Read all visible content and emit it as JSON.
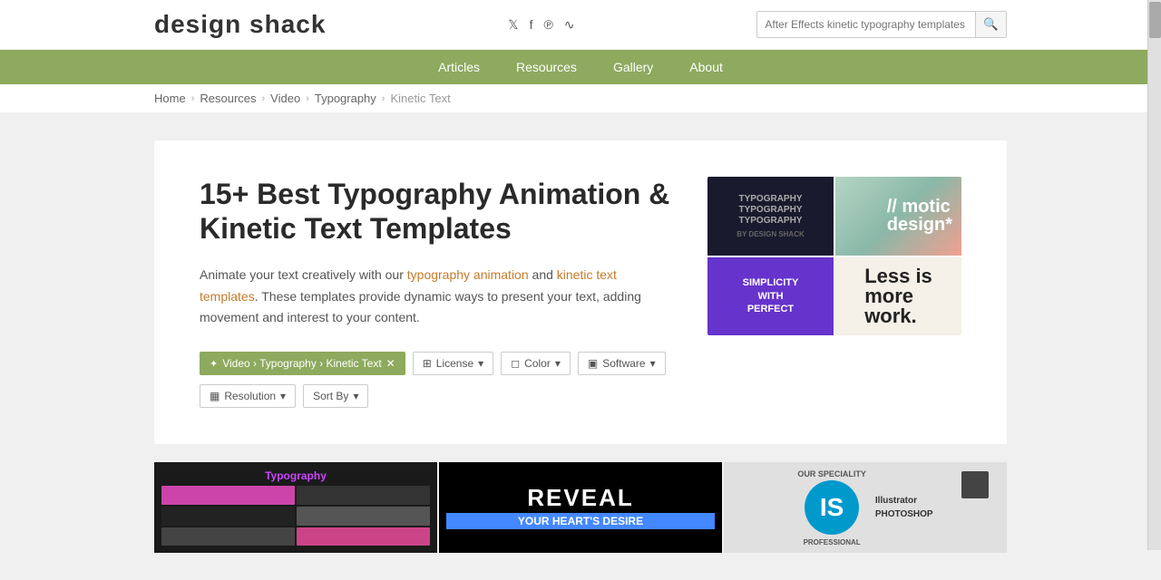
{
  "site": {
    "logo_part1": "design ",
    "logo_part2": "shack"
  },
  "social": {
    "twitter": "𝕏",
    "facebook": "f",
    "pinterest": "𝐏",
    "rss": "RSS"
  },
  "search": {
    "placeholder": "After Effects kinetic typography templates",
    "button_label": "🔍"
  },
  "nav": {
    "items": [
      {
        "label": "Articles",
        "id": "articles"
      },
      {
        "label": "Resources",
        "id": "resources"
      },
      {
        "label": "Gallery",
        "id": "gallery"
      },
      {
        "label": "About",
        "id": "about"
      }
    ]
  },
  "breadcrumb": {
    "items": [
      {
        "label": "Home",
        "id": "home"
      },
      {
        "label": "Resources",
        "id": "resources"
      },
      {
        "label": "Video",
        "id": "video"
      },
      {
        "label": "Typography",
        "id": "typography"
      },
      {
        "label": "Kinetic Text",
        "id": "kinetic-text"
      }
    ]
  },
  "page": {
    "title": "15+ Best Typography Animation & Kinetic Text Templates",
    "description": "Animate your text creatively with our typography animation and kinetic text templates. These templates provide dynamic ways to present your text, adding movement and interest to your content.",
    "desc_link1": "typography animation",
    "desc_link2": "kinetic text templates"
  },
  "filters": {
    "active_filter": "Video › Typography › Kinetic Text",
    "items": [
      {
        "label": "License",
        "id": "license"
      },
      {
        "label": "Color",
        "id": "color"
      },
      {
        "label": "Software",
        "id": "software"
      }
    ],
    "secondary": [
      {
        "label": "Resolution",
        "id": "resolution"
      },
      {
        "label": "Sort By",
        "id": "sort-by"
      }
    ]
  },
  "hero": {
    "cell1_lines": [
      "TYPOGRAPHY",
      "TYPOGRAPHY",
      "TYPOGRAPHY"
    ],
    "cell2_text": "// motic\ndesign*",
    "cell3_text": "SIMPLICITY\nWITH\nPERFECT",
    "cell4_line1": "Less is",
    "cell4_line2": "more",
    "cell4_line3": "work."
  },
  "thumbnails": {
    "thumb1_label": "Typography",
    "thumb2_reveal": "REVEAL",
    "thumb2_desire": "YOUR HEART'S DESIRE",
    "thumb3_top": "Illustrator",
    "thumb3_is": "IS",
    "thumb3_bottom": "PHOTOSHOP"
  }
}
